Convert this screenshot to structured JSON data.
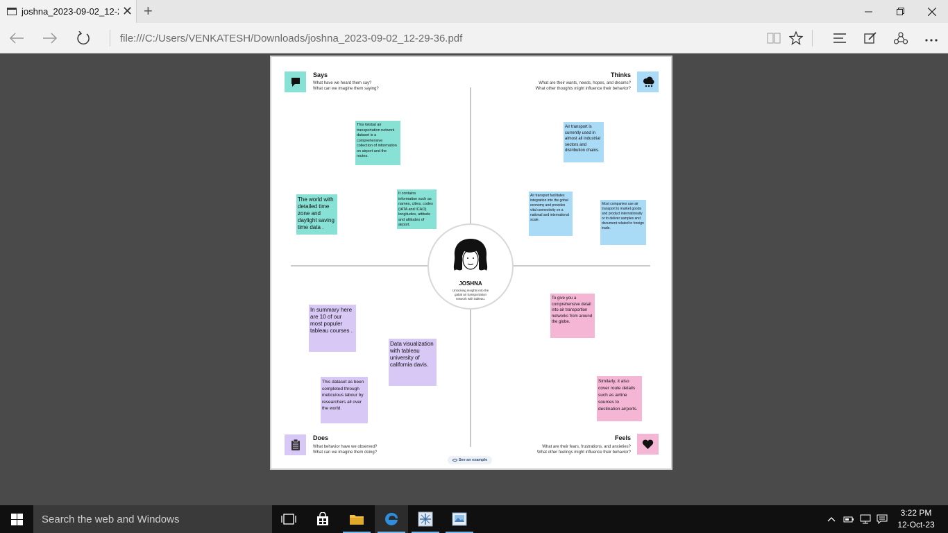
{
  "browser": {
    "tab_title": "joshna_2023-09-02_12-2",
    "tab_close": "✕",
    "new_tab": "+",
    "url": "file:///C:/Users/VENKATESH/Downloads/joshna_2023-09-02_12-29-36.pdf"
  },
  "empathy_map": {
    "says": {
      "title": "Says",
      "line1": "What have we heard them say?",
      "line2": "What can we imagine them saying?"
    },
    "thinks": {
      "title": "Thinks",
      "line1": "What are their wants, needs, hopes, and dreams?",
      "line2": "What other thoughts might influence their behavior?"
    },
    "does": {
      "title": "Does",
      "line1": "What behavior have we observed?",
      "line2": "What can we imagine them doing?"
    },
    "feels": {
      "title": "Feels",
      "line1": "What are their fears, frustrations, and anxieties?",
      "line2": "What other feelings might influence their behavior?"
    },
    "persona": {
      "name": "JOSHNA",
      "description": "Unlocking insights into the gabal air transportation network with tableau."
    },
    "notes": {
      "says_1": "This Global air transportation network dataset is a comprehensive collection of information on airport and the routes.",
      "says_2": "The world with detailed time zone and daylight saving time data .",
      "says_3": "It contains information such as names, cities, codes (IATA and ICAO) longitudes, attitude and altitudes of airport.",
      "thinks_1": "Air transport is currently used in almost all industrial sectors and distribution chains.",
      "thinks_2": "Air transport facilitates integration into the gobal economy and provides vital connectivity on a national and international scale.",
      "thinks_3": "Most companies use air transport to market goods and product internationally or to deliver samples and document related to foreign trade.",
      "does_1": "In summary here are 10 of our most populer tableau courses .",
      "does_2": "Data visualization with tableau university of california davis.",
      "does_3": "This dataset as been completed through meticulous labour by researchers all over the world.",
      "feels_1": "To give you a comprehensive detail into air transportion networks from around the globe.",
      "feels_2": "Similarly, it also cover route details such as airline sources to destination airports."
    },
    "see_example": "See an example"
  },
  "taskbar": {
    "search_placeholder": "Search the web and Windows",
    "time": "3:22 PM",
    "date": "12-Oct-23"
  },
  "colors": {
    "says": "#87e1d4",
    "thinks": "#a9daf6",
    "does": "#d7c8f6",
    "feels": "#f5b6d6"
  }
}
